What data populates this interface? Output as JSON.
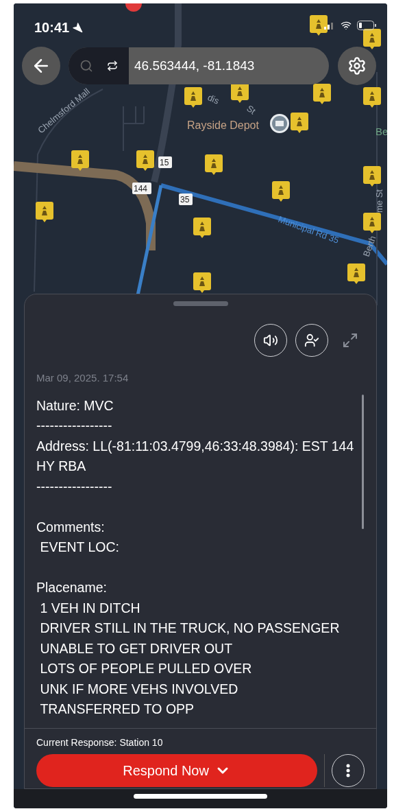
{
  "status_bar": {
    "time": "10:41"
  },
  "search": {
    "value": "46.563444, -81.1843"
  },
  "map": {
    "labels": [
      {
        "kind": "street",
        "text": "Chelmsford Mall"
      },
      {
        "kind": "street",
        "text": "dis"
      },
      {
        "kind": "street",
        "text": "St"
      },
      {
        "kind": "place",
        "text": "Rayside Depot"
      },
      {
        "kind": "park",
        "text": "Be"
      },
      {
        "kind": "road",
        "text": "Municipal Rd 35"
      },
      {
        "kind": "street",
        "text": "Berth"
      },
      {
        "kind": "street",
        "text": "me St"
      }
    ],
    "shields": [
      "15",
      "144",
      "35"
    ]
  },
  "sheet": {
    "date": "Mar 09, 2025. 17:54",
    "paragraphs": [
      [
        "Nature: MVC",
        "-----------------",
        "Address: LL(-81:11:03.4799,46:33:48.3984): EST 144 HY RBA",
        "-----------------"
      ],
      [
        "Comments:",
        " EVENT LOC:"
      ],
      [
        "Placename:",
        " 1 VEH IN DITCH",
        " DRIVER STILL IN THE TRUCK, NO PASSENGER",
        " UNABLE TO GET DRIVER OUT",
        " LOTS OF PEOPLE PULLED OVER",
        " UNK IF MORE VEHS INVOLVED",
        " TRANSFERRED TO OPP"
      ]
    ],
    "current_response": "Current Response: Station 10",
    "respond_button": "Respond Now"
  }
}
